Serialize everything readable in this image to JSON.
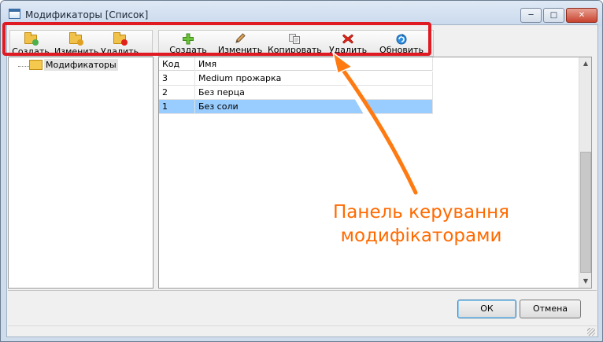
{
  "window": {
    "title": "Модификаторы [Список]"
  },
  "toolbar_groups": {
    "buttons": [
      {
        "label": "Создать",
        "icon": "folder-add-icon"
      },
      {
        "label": "Изменить",
        "icon": "folder-edit-icon"
      },
      {
        "label": "Удалить",
        "icon": "folder-delete-icon"
      }
    ]
  },
  "toolbar_items": {
    "buttons": [
      {
        "label": "Создать",
        "icon": "plus-icon"
      },
      {
        "label": "Изменить",
        "icon": "pencil-icon"
      },
      {
        "label": "Копировать",
        "icon": "copy-icon"
      },
      {
        "label": "Удалить",
        "icon": "delete-x-icon"
      },
      {
        "label": "Обновить",
        "icon": "refresh-icon"
      }
    ]
  },
  "tree": {
    "root_label": "Модификаторы"
  },
  "grid": {
    "columns": [
      "Код",
      "Имя"
    ],
    "rows": [
      {
        "code": "3",
        "name": "Medium прожарка"
      },
      {
        "code": "2",
        "name": "Без перца"
      },
      {
        "code": "1",
        "name": "Без соли"
      }
    ],
    "selected_row": 2
  },
  "dialog": {
    "ok_label": "ОК",
    "cancel_label": "Отмена"
  },
  "annotation": {
    "line1": "Панель керування",
    "line2": "модифікаторами",
    "color": "#ff6a00",
    "frame_color": "#e01a22"
  },
  "colors": {
    "selection": "#99ccff",
    "accent": "#3a6ea5"
  }
}
